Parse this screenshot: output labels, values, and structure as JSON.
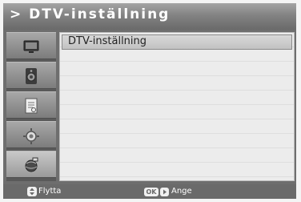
{
  "header": {
    "title": "> DTV-inställning"
  },
  "sidebar": {
    "items": [
      {
        "icon": "tv-screen-icon"
      },
      {
        "icon": "speaker-icon"
      },
      {
        "icon": "document-icon"
      },
      {
        "icon": "gear-icon"
      },
      {
        "icon": "satellite-globe-icon"
      }
    ],
    "active_index": 4
  },
  "menu": {
    "items": [
      {
        "label": "DTV-inställning",
        "selected": true
      }
    ]
  },
  "footer": {
    "move_label": "Flytta",
    "ok_key": "OK",
    "enter_label": "Ange"
  }
}
